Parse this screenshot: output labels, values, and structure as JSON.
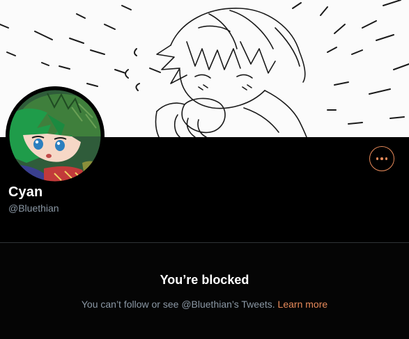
{
  "profile": {
    "display_name": "Cyan",
    "handle": "@Bluethian"
  },
  "header": {
    "more_icon": "more-horizontal-icon"
  },
  "blocked": {
    "title": "You’re blocked",
    "message": "You can’t follow or see @Bluethian’s Tweets.",
    "learn_more": "Learn more"
  },
  "colors": {
    "background": "#000000",
    "accent": "#e88a5a",
    "secondary_text": "#8b98a5",
    "divider": "#2f3336"
  }
}
